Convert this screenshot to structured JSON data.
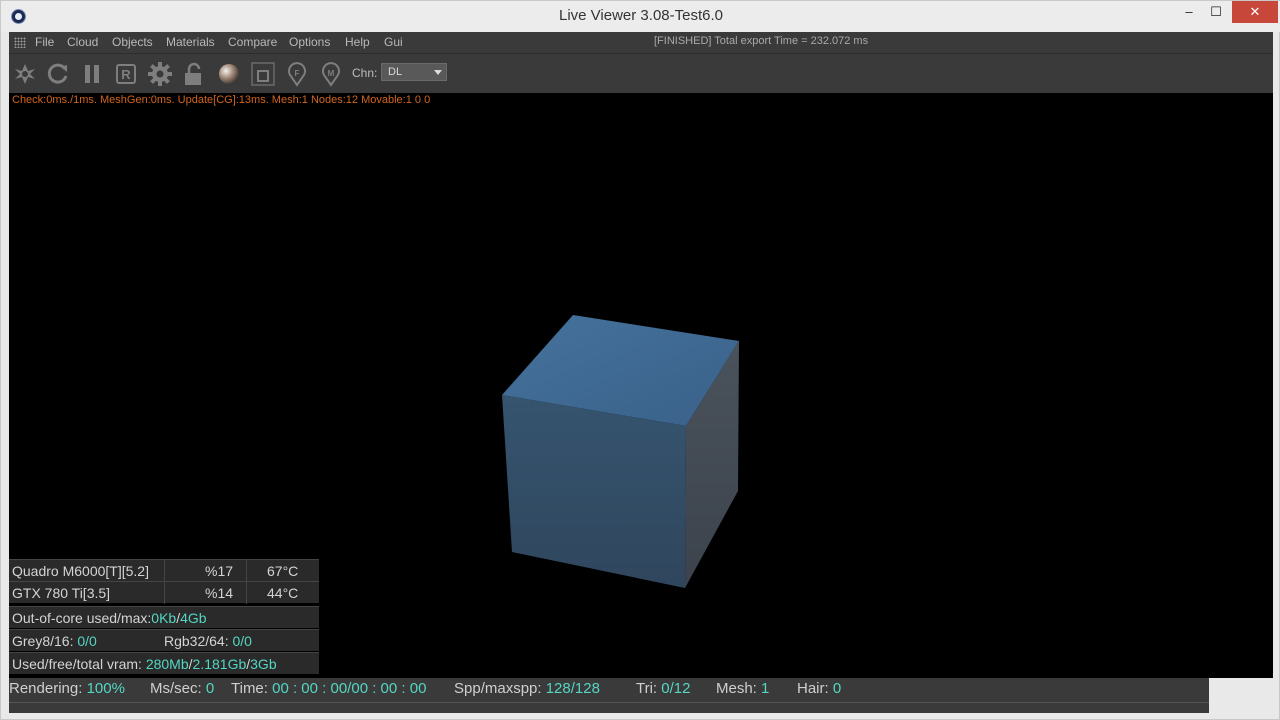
{
  "window": {
    "title": "Live Viewer 3.08-Test6.0",
    "minimize_glyph": "–",
    "maximize_glyph": "☐",
    "close_glyph": "✕"
  },
  "menu": {
    "items": [
      "File",
      "Cloud",
      "Objects",
      "Materials",
      "Compare",
      "Options",
      "Help",
      "Gui"
    ],
    "status": "[FINISHED] Total export Time = 232.072 ms"
  },
  "toolbar": {
    "icons": [
      "send-scene-icon",
      "restart-icon",
      "pause-icon",
      "region-render-icon",
      "settings-icon",
      "lock-icon",
      "material-ball-icon",
      "focus-picker-icon",
      "focus-pin-icon",
      "material-pin-icon"
    ],
    "chn_label": "Chn:",
    "chn_value": "DL"
  },
  "viewport": {
    "debug_line": "Check:0ms./1ms. MeshGen:0ms. Update[CG]:13ms. Mesh:1 Nodes:12 Movable:1  0 0",
    "cube_top_color": "#3f6a93",
    "cube_front_color": "#34506d",
    "cube_side_color": "#454d57"
  },
  "stats": {
    "gpus": [
      {
        "name": "Quadro M6000[T][5.2]",
        "usage": "%17",
        "temp": "67°C"
      },
      {
        "name": "GTX 780 Ti[3.5]",
        "usage": "%14",
        "temp": "44°C"
      }
    ],
    "ooc_label": "Out-of-core used/max:",
    "ooc_used": "0Kb",
    "ooc_sep": "/",
    "ooc_max": "4Gb",
    "grey_label": "Grey8/16:",
    "grey_value": "0/0",
    "rgb_label": "Rgb32/64:",
    "rgb_value": "0/0",
    "vram_label": "Used/free/total vram:",
    "vram_used": "280Mb",
    "vram_sep1": "/",
    "vram_free": "2.181Gb",
    "vram_sep2": "/",
    "vram_total": "3Gb"
  },
  "statusbar": {
    "rendering_label": "Rendering:",
    "rendering_value": "100%",
    "mssec_label": "Ms/sec:",
    "mssec_value": "0",
    "time_label": "Time:",
    "time_value": "00 : 00 : 00/00 : 00 : 00",
    "spp_label": "Spp/maxspp:",
    "spp_value": "128/128",
    "tri_label": "Tri:",
    "tri_value": "0/12",
    "mesh_label": "Mesh:",
    "mesh_value": "1",
    "hair_label": "Hair:",
    "hair_value": "0"
  },
  "colors": {
    "accent_value": "#54d6c2",
    "debug_text": "#d2651f",
    "close_button": "#c7473a"
  }
}
